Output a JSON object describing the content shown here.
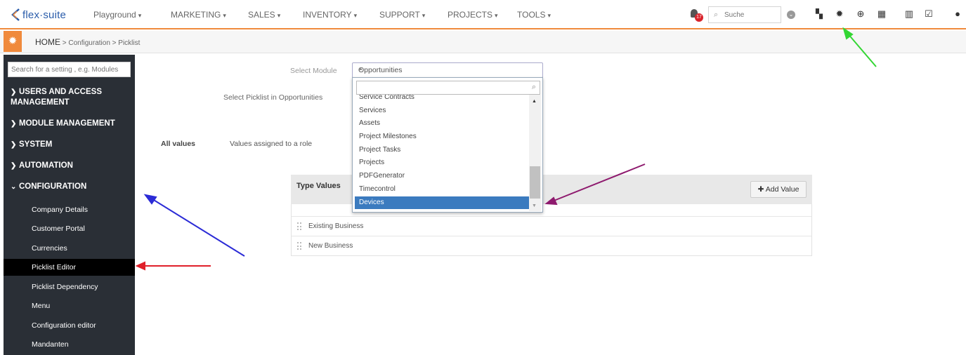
{
  "topnav": {
    "logo_text": "flex·suite",
    "menus": [
      {
        "label": "Playground"
      },
      {
        "label": "MARKETING"
      },
      {
        "label": "SALES"
      },
      {
        "label": "INVENTORY"
      },
      {
        "label": "SUPPORT"
      },
      {
        "label": "PROJECTS"
      },
      {
        "label": "TOOLS"
      }
    ],
    "notification_count": "17",
    "search_placeholder": "Suche"
  },
  "breadcrumb": {
    "home": "HOME",
    "path": " > Configuration > Picklist"
  },
  "sidebar": {
    "search_placeholder": "Search for a setting , e.g. Modules",
    "sections": [
      {
        "label": "USERS AND ACCESS MANAGEMENT",
        "expanded": false
      },
      {
        "label": "MODULE MANAGEMENT",
        "expanded": false
      },
      {
        "label": "SYSTEM",
        "expanded": false
      },
      {
        "label": "AUTOMATION",
        "expanded": false
      },
      {
        "label": "CONFIGURATION",
        "expanded": true
      }
    ],
    "items": [
      {
        "label": "Company Details"
      },
      {
        "label": "Customer Portal"
      },
      {
        "label": "Currencies"
      },
      {
        "label": "Picklist Editor",
        "active": true
      },
      {
        "label": "Picklist Dependency"
      },
      {
        "label": "Menu"
      },
      {
        "label": "Configuration editor"
      },
      {
        "label": "Mandanten"
      }
    ]
  },
  "main": {
    "select_module_label": "Select Module",
    "select_module_value": "Opportunities",
    "select_picklist_label": "Select Picklist in Opportunities",
    "tab_all_values": "All values",
    "tab_role_values": "Values assigned to a role",
    "dropdown_options": [
      {
        "label": "Service Contracts"
      },
      {
        "label": "Services"
      },
      {
        "label": "Assets"
      },
      {
        "label": "Project Milestones"
      },
      {
        "label": "Project Tasks"
      },
      {
        "label": "Projects"
      },
      {
        "label": "PDFGenerator"
      },
      {
        "label": "Timecontrol"
      },
      {
        "label": "Devices",
        "selected": true
      }
    ],
    "type_values_header": "Type Values",
    "add_value_label": "Add Value",
    "values": [
      {
        "label": "Existing Business"
      },
      {
        "label": "New Business"
      }
    ]
  },
  "colors": {
    "accent_orange": "#f08a3c",
    "sidebar_bg": "#2a2f36",
    "selected_blue": "#3b7bbf",
    "arrow_green": "#33d633",
    "arrow_blue": "#2b2bd6",
    "arrow_red": "#e0202a",
    "arrow_purple": "#8e1a6e"
  }
}
